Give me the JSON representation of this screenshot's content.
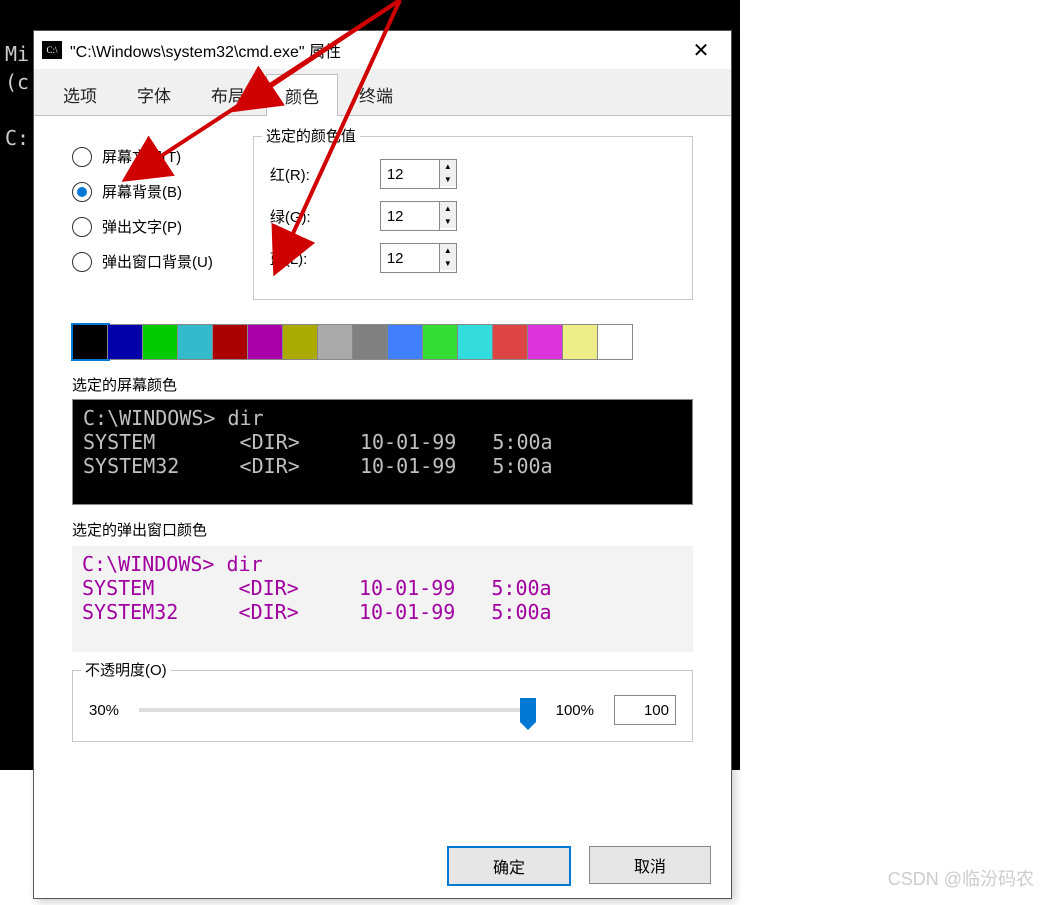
{
  "cmd_window": {
    "title": "C:\\Windows\\system32\\cmd.exe",
    "text": "Mi\n(c\n\nC:"
  },
  "dialog": {
    "title": "\"C:\\Windows\\system32\\cmd.exe\" 属性",
    "tabs": [
      "选项",
      "字体",
      "布局",
      "颜色",
      "终端"
    ],
    "close": "✕",
    "radios": {
      "screen_text": "屏幕文字(T)",
      "screen_bg": "屏幕背景(B)",
      "popup_text": "弹出文字(P)",
      "popup_bg": "弹出窗口背景(U)"
    },
    "rgb": {
      "legend": "选定的颜色值",
      "red_label": "红(R):",
      "red": "12",
      "green_label": "绿(G):",
      "green": "12",
      "blue_label": "蓝(L):",
      "blue": "12"
    },
    "palette": [
      "#000000",
      "#0000aa",
      "#00cc00",
      "#33bbcc",
      "#aa0000",
      "#aa00aa",
      "#aaaa00",
      "#aaaaaa",
      "#808080",
      "#4080ff",
      "#33dd33",
      "#33dddd",
      "#dd4444",
      "#dd33dd",
      "#eeee88",
      "#ffffff"
    ],
    "preview_screen_label": "选定的屏幕颜色",
    "preview_popup_label": "选定的弹出窗口颜色",
    "preview_text": "C:\\WINDOWS> dir\nSYSTEM       <DIR>     10-01-99   5:00a\nSYSTEM32     <DIR>     10-01-99   5:00a",
    "opacity": {
      "label": "不透明度(O)",
      "min_label": "30%",
      "max_label": "100%",
      "value": "100"
    },
    "ok": "确定",
    "cancel": "取消"
  },
  "watermark": "CSDN @临汾码农"
}
